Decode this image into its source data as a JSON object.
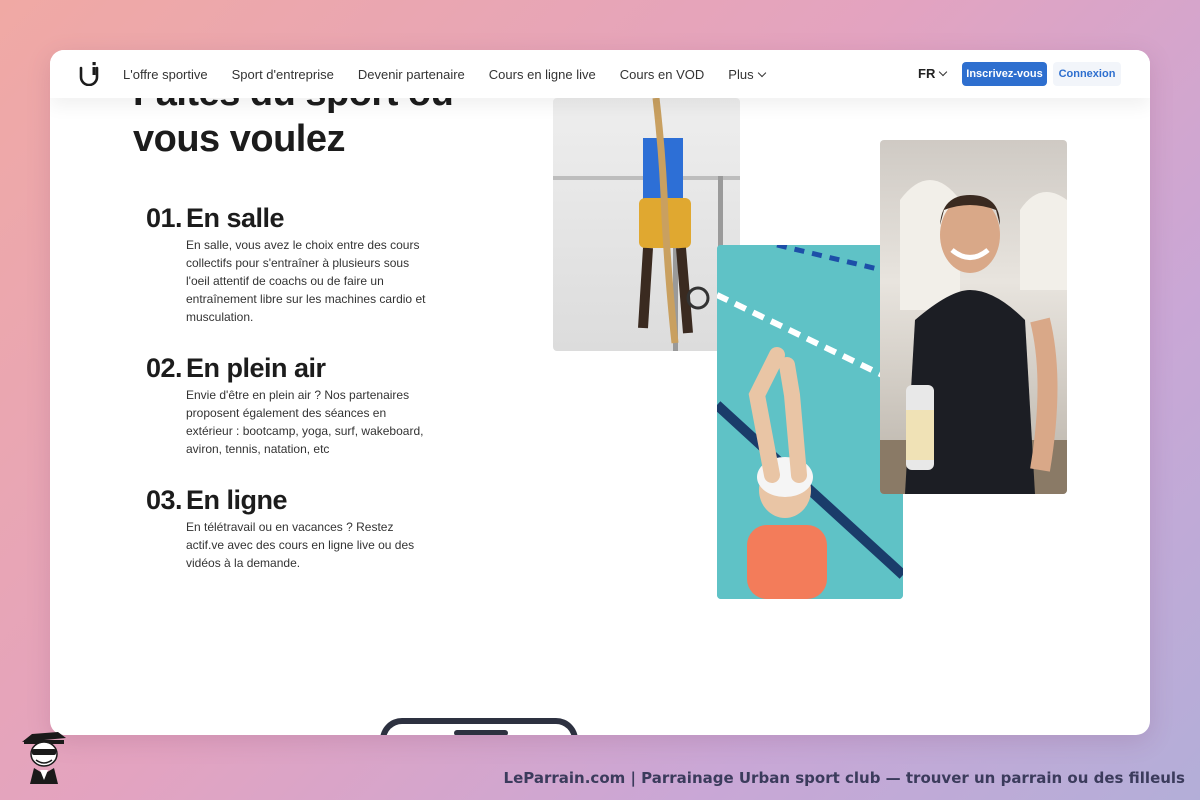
{
  "nav": {
    "links": [
      "L'offre sportive",
      "Sport d'entreprise",
      "Devenir partenaire",
      "Cours en ligne live",
      "Cours en VOD",
      "Plus"
    ],
    "lang": "FR",
    "signup_label": "Inscrivez-vous",
    "login_label": "Connexion"
  },
  "hero": {
    "title_line1": "Faites du sport où",
    "title_line2": "vous voulez"
  },
  "features": [
    {
      "num": "01.",
      "title": "En salle",
      "desc": "En salle, vous avez le choix entre des cours collectifs pour s'entraîner à plusieurs sous l'oeil attentif de coachs ou de faire un entraînement libre sur les machines cardio et musculation."
    },
    {
      "num": "02.",
      "title": "En plein air",
      "desc": "Envie d'être en plein air ? Nos partenaires proposent également des séances en extérieur : bootcamp, yoga, surf, wakeboard, aviron, tennis, natation, etc"
    },
    {
      "num": "03.",
      "title": "En ligne",
      "desc": "En télétravail ou en vacances ? Restez actif.ve avec des cours en ligne live ou des vidéos à la demande."
    }
  ],
  "footer": {
    "text": "LeParrain.com | Parrainage Urban sport club — trouver un parrain ou des filleuls"
  },
  "colors": {
    "accent": "#2e6fcf",
    "text": "#1c1c1c",
    "background_gradient_start": "#f0a9a4",
    "background_gradient_end": "#b3aed8"
  }
}
